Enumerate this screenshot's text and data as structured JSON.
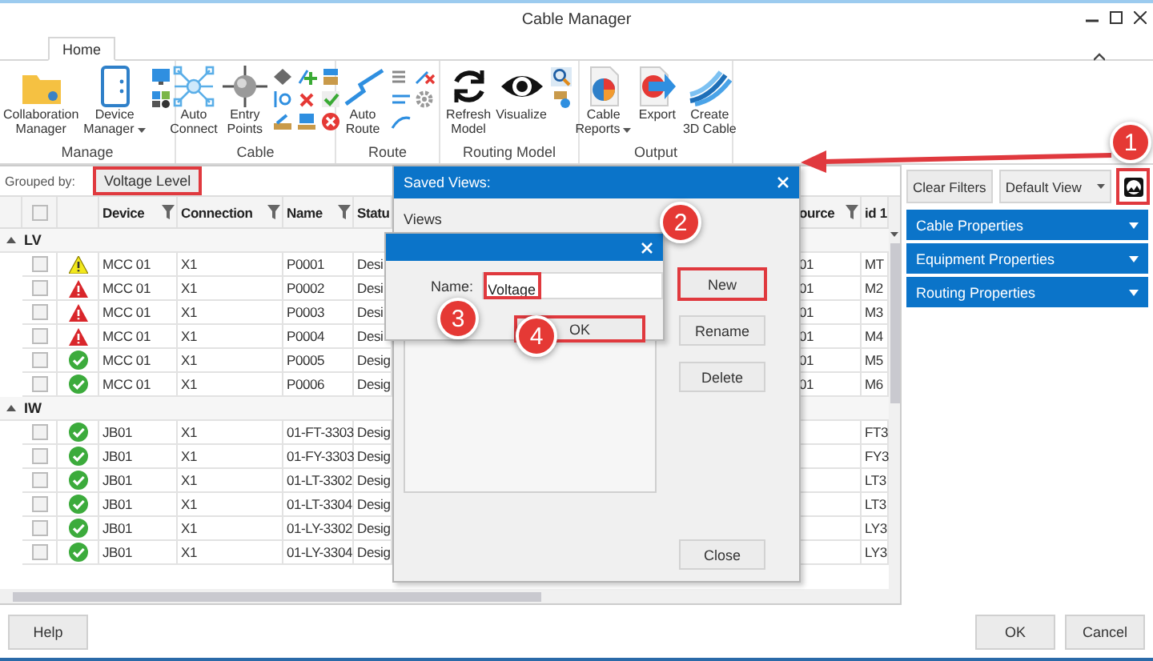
{
  "window": {
    "title": "Cable Manager"
  },
  "tabs": [
    {
      "label": "Home",
      "selected": true
    }
  ],
  "ribbon": [
    {
      "label": "Manage",
      "buttons": [
        {
          "label": "Collaboration\nManager",
          "dropdown": false
        },
        {
          "label": "Device\nManager",
          "dropdown": true
        }
      ]
    },
    {
      "label": "Cable",
      "buttons": [
        {
          "label": "Auto\nConnect",
          "dropdown": false
        },
        {
          "label": "Entry\nPoints",
          "dropdown": false
        }
      ]
    },
    {
      "label": "Route",
      "buttons": [
        {
          "label": "Auto\nRoute",
          "dropdown": false
        }
      ]
    },
    {
      "label": "Routing Model",
      "buttons": [
        {
          "label": "Refresh\nModel",
          "dropdown": false
        },
        {
          "label": "Visualize",
          "dropdown": false
        }
      ]
    },
    {
      "label": "Output",
      "buttons": [
        {
          "label": "Cable\nReports",
          "dropdown": true
        },
        {
          "label": "Export",
          "dropdown": false
        },
        {
          "label": "Create\n3D Cable",
          "dropdown": false
        }
      ]
    }
  ],
  "grouped_by": {
    "label": "Grouped by:",
    "chip": "Voltage Level",
    "highlighted": true
  },
  "grid": {
    "header_checked": false,
    "columns": [
      {
        "label": "Device",
        "filter": true
      },
      {
        "label": "Connection",
        "filter": true
      },
      {
        "label": "Name",
        "filter": true
      },
      {
        "label": "Statu"
      },
      {
        "label": "ource",
        "filter": true
      },
      {
        "label": "id 1"
      }
    ],
    "groups": [
      {
        "label": "LV",
        "expanded": true,
        "rows": [
          {
            "kind": "warning",
            "checked": false,
            "device": "MCC 01",
            "connection": "X1",
            "name": "P0001",
            "status": "Desi",
            "source": "01",
            "id": "MT"
          },
          {
            "kind": "error",
            "checked": false,
            "device": "MCC 01",
            "connection": "X1",
            "name": "P0002",
            "status": "Desi",
            "source": "01",
            "id": "M2"
          },
          {
            "kind": "error",
            "checked": false,
            "device": "MCC 01",
            "connection": "X1",
            "name": "P0003",
            "status": "Desi",
            "source": "01",
            "id": "M3"
          },
          {
            "kind": "error",
            "checked": false,
            "device": "MCC 01",
            "connection": "X1",
            "name": "P0004",
            "status": "Desi",
            "source": "01",
            "id": "M4"
          },
          {
            "kind": "ok",
            "checked": false,
            "device": "MCC 01",
            "connection": "X1",
            "name": "P0005",
            "status": "Desig",
            "source": "01",
            "id": "M5"
          },
          {
            "kind": "ok",
            "checked": false,
            "device": "MCC 01",
            "connection": "X1",
            "name": "P0006",
            "status": "Desig",
            "source": "01",
            "id": "M6"
          }
        ]
      },
      {
        "label": "IW",
        "expanded": true,
        "rows": [
          {
            "kind": "ok",
            "checked": false,
            "device": "JB01",
            "connection": "X1",
            "name": "01-FT-3303",
            "status": "Desig",
            "id": "FT3"
          },
          {
            "kind": "ok",
            "checked": false,
            "device": "JB01",
            "connection": "X1",
            "name": "01-FY-3303",
            "status": "Desig",
            "id": "FY3"
          },
          {
            "kind": "ok",
            "checked": false,
            "device": "JB01",
            "connection": "X1",
            "name": "01-LT-3302",
            "status": "Desig",
            "id": "LT3"
          },
          {
            "kind": "ok",
            "checked": false,
            "device": "JB01",
            "connection": "X1",
            "name": "01-LT-3304",
            "status": "Desig",
            "id": "LT3"
          },
          {
            "kind": "ok",
            "checked": false,
            "device": "JB01",
            "connection": "X1",
            "name": "01-LY-3302",
            "status": "Desig",
            "id": "LY3"
          },
          {
            "kind": "ok",
            "checked": false,
            "device": "JB01",
            "connection": "X1",
            "name": "01-LY-3304",
            "status": "Desig",
            "id": "LY3"
          }
        ]
      }
    ]
  },
  "right_panel": {
    "clear_filters": "Clear Filters",
    "view": "Default View",
    "icon_highlighted": true,
    "sections": [
      {
        "label": "Cable Properties"
      },
      {
        "label": "Equipment Properties"
      },
      {
        "label": "Routing Properties"
      }
    ]
  },
  "saved_views_dialog": {
    "title": "Saved Views:",
    "list_label": "Views",
    "buttons": [
      {
        "label": "New",
        "highlighted": true
      },
      {
        "label": "Rename",
        "highlighted": false
      },
      {
        "label": "Delete",
        "highlighted": false
      }
    ],
    "close": "Close"
  },
  "name_dialog": {
    "label": "Name:",
    "value": "Voltage",
    "value_highlighted": true,
    "ok": {
      "label": "OK",
      "highlighted": true
    }
  },
  "callouts": [
    "1",
    "2",
    "3",
    "4"
  ],
  "footer": {
    "help": "Help",
    "ok": "OK",
    "cancel": "Cancel"
  }
}
